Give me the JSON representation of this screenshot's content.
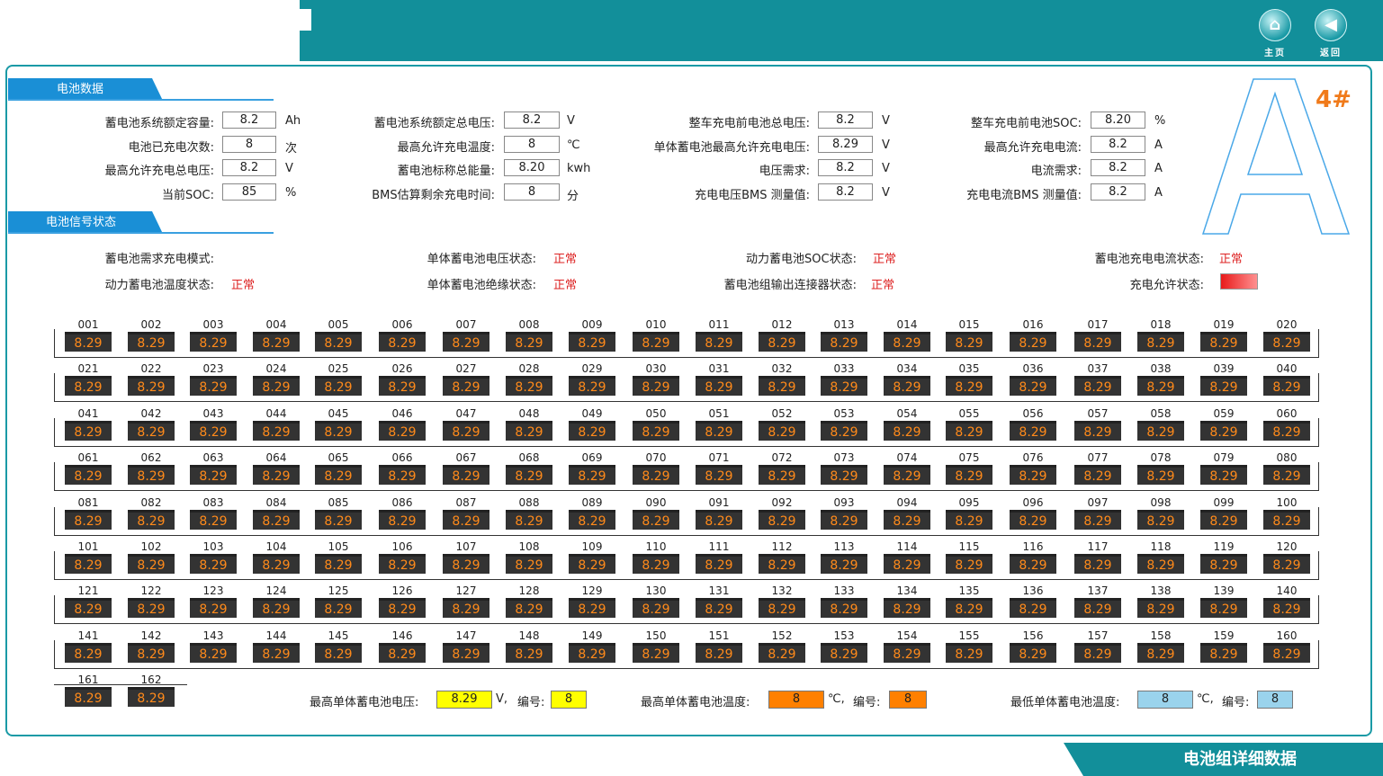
{
  "nav": {
    "home_label": "主页",
    "back_label": "返回"
  },
  "battery_data": {
    "section_title": "电池数据",
    "fields": [
      {
        "label": "蓄电池系统额定容量:",
        "value": "8.2",
        "unit": "Ah"
      },
      {
        "label": "电池已充电次数:",
        "value": "8",
        "unit": "次"
      },
      {
        "label": "最高允许充电总电压:",
        "value": "8.2",
        "unit": "V"
      },
      {
        "label": "当前SOC:",
        "value": "85",
        "unit": "%"
      },
      {
        "label": "蓄电池系统额定总电压:",
        "value": "8.2",
        "unit": "V"
      },
      {
        "label": "最高允许充电温度:",
        "value": "8",
        "unit": "℃"
      },
      {
        "label": "蓄电池标称总能量:",
        "value": "8.20",
        "unit": "kwh"
      },
      {
        "label": "BMS估算剩余充电时间:",
        "value": "8",
        "unit": "分"
      },
      {
        "label": "整车充电前电池总电压:",
        "value": "8.2",
        "unit": "V"
      },
      {
        "label": "单体蓄电池最高允许充电电压:",
        "value": "8.29",
        "unit": "V"
      },
      {
        "label": "电压需求:",
        "value": "8.2",
        "unit": "V"
      },
      {
        "label": "充电电压BMS 测量值:",
        "value": "8.2",
        "unit": "V"
      },
      {
        "label": "整车充电前电池SOC:",
        "value": "8.20",
        "unit": "%"
      },
      {
        "label": "最高允许充电电流:",
        "value": "8.2",
        "unit": "A"
      },
      {
        "label": "电流需求:",
        "value": "8.2",
        "unit": "A"
      },
      {
        "label": "充电电流BMS 测量值:",
        "value": "8.2",
        "unit": "A"
      }
    ]
  },
  "gun": {
    "letter": "A",
    "number": "4#"
  },
  "signal_state": {
    "section_title": "电池信号状态",
    "items": [
      {
        "label": "蓄电池需求充电模式:",
        "value": ""
      },
      {
        "label": "单体蓄电池电压状态:",
        "value": "正常"
      },
      {
        "label": "动力蓄电池SOC状态:",
        "value": "正常"
      },
      {
        "label": "蓄电池充电电流状态:",
        "value": "正常"
      },
      {
        "label": "动力蓄电池温度状态:",
        "value": "正常"
      },
      {
        "label": "单体蓄电池绝缘状态:",
        "value": "正常"
      },
      {
        "label": "蓄电池组输出连接器状态:",
        "value": "正常"
      },
      {
        "label": "充电允许状态:",
        "value": ""
      }
    ]
  },
  "cells": {
    "count": 162,
    "value": "8.29"
  },
  "summary": {
    "max_voltage_label": "最高单体蓄电池电压:",
    "max_voltage": "8.29",
    "max_voltage_unit": "V,",
    "max_voltage_id_label": "编号:",
    "max_voltage_id": "8",
    "max_temp_label": "最高单体蓄电池温度:",
    "max_temp": "8",
    "max_temp_unit": "℃,",
    "max_temp_id_label": "编号:",
    "max_temp_id": "8",
    "min_temp_label": "最低单体蓄电池温度:",
    "min_temp": "8",
    "min_temp_unit": "℃,",
    "min_temp_id_label": "编号:",
    "min_temp_id": "8",
    "colors": {
      "max_voltage": "#ffff00",
      "max_temp": "#ff8000",
      "min_temp": "#9ad3ec"
    }
  },
  "footer": {
    "title": "电池组详细数据"
  }
}
